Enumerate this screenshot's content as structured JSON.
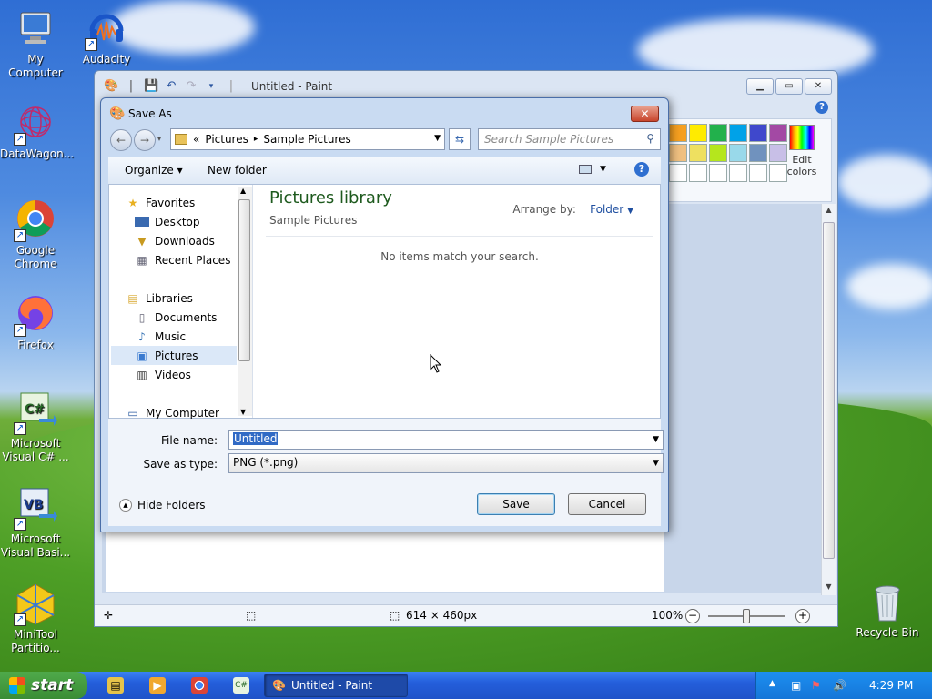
{
  "desktop": {
    "icons": [
      {
        "label": "My Computer",
        "icon": "computer-icon"
      },
      {
        "label": "Audacity",
        "icon": "audacity-icon"
      },
      {
        "label": "DataWagon...",
        "icon": "datawagon-icon"
      },
      {
        "label": "Google Chrome",
        "icon": "chrome-icon"
      },
      {
        "label": "Firefox",
        "icon": "firefox-icon"
      },
      {
        "label": "Microsoft Visual C# ...",
        "icon": "visual-csharp-icon"
      },
      {
        "label": "Microsoft Visual Basi...",
        "icon": "visual-basic-icon"
      },
      {
        "label": "MiniTool Partitio...",
        "icon": "minitool-icon"
      },
      {
        "label": "Recycle Bin",
        "icon": "recycle-bin-icon"
      }
    ]
  },
  "paint": {
    "title": "Untitled - Paint",
    "edit_colors": "Edit colors",
    "palette": [
      "#f6a020",
      "#ffeb00",
      "#22b14c",
      "#00a2e8",
      "#3f48cc",
      "#a349a4",
      "#f0c080",
      "#eee060",
      "#b5e61d",
      "#99d9ea",
      "#7092be",
      "#c8bfe7",
      "#ffffff",
      "#ffffff",
      "#ffffff",
      "#ffffff",
      "#ffffff",
      "#ffffff"
    ],
    "status": {
      "dimensions": "614 × 460px",
      "zoom": "100%"
    }
  },
  "dialog": {
    "title": "Save As",
    "close_glyph": "✕",
    "breadcrumb": {
      "overflow": "«",
      "part1": "Pictures",
      "sep": "▸",
      "part2": "Sample Pictures"
    },
    "search_placeholder": "Search Sample Pictures",
    "organize": "Organize ▾",
    "new_folder": "New folder",
    "nav": {
      "favorites": "Favorites",
      "desktop": "Desktop",
      "downloads": "Downloads",
      "recent_places": "Recent Places",
      "libraries": "Libraries",
      "documents": "Documents",
      "music": "Music",
      "pictures": "Pictures",
      "videos": "Videos",
      "my_computer": "My Computer"
    },
    "library_title": "Pictures library",
    "library_subtitle": "Sample Pictures",
    "arrange_label": "Arrange by:",
    "arrange_value": "Folder",
    "empty_message": "No items match your search.",
    "file_name_label": "File name:",
    "file_name_value": "Untitled",
    "save_type_label": "Save as type:",
    "save_type_value": "PNG (*.png)",
    "hide_folders": "Hide Folders",
    "save_button": "Save",
    "cancel_button": "Cancel"
  },
  "taskbar": {
    "start": "start",
    "task": "Untitled - Paint",
    "clock": "4:29 PM"
  }
}
